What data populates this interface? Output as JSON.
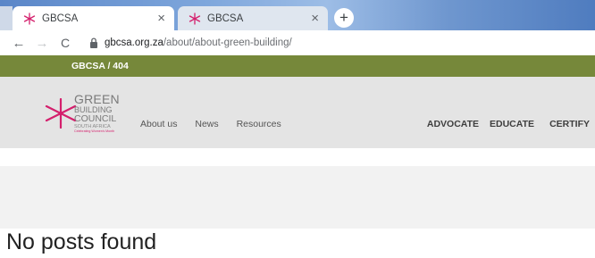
{
  "browser": {
    "tabs": [
      {
        "title": "GBCSA",
        "active": true
      },
      {
        "title": "GBCSA",
        "active": false
      }
    ],
    "new_tab_icon": "plus-icon",
    "close_glyph": "×",
    "new_tab_glyph": "+",
    "nav": {
      "back_glyph": "←",
      "forward_glyph": "→",
      "reload_glyph": "C"
    },
    "address": {
      "domain": "gbcsa.org.za",
      "path": "/about/about-green-building/"
    }
  },
  "site": {
    "breadcrumb": "GBCSA / 404",
    "logo": {
      "line1": "GREEN",
      "line2": "BUILDING",
      "line3": "COUNCIL",
      "line4": "SOUTH AFRICA",
      "line5": "Celebrating Women's Month",
      "mark_color": "#d41f6c"
    },
    "nav_left": [
      "About us",
      "News",
      "Resources"
    ],
    "nav_right": [
      "ADVOCATE",
      "EDUCATE",
      "CERTIFY"
    ],
    "accent_color": "#76883a"
  },
  "main": {
    "message": "No posts found"
  }
}
